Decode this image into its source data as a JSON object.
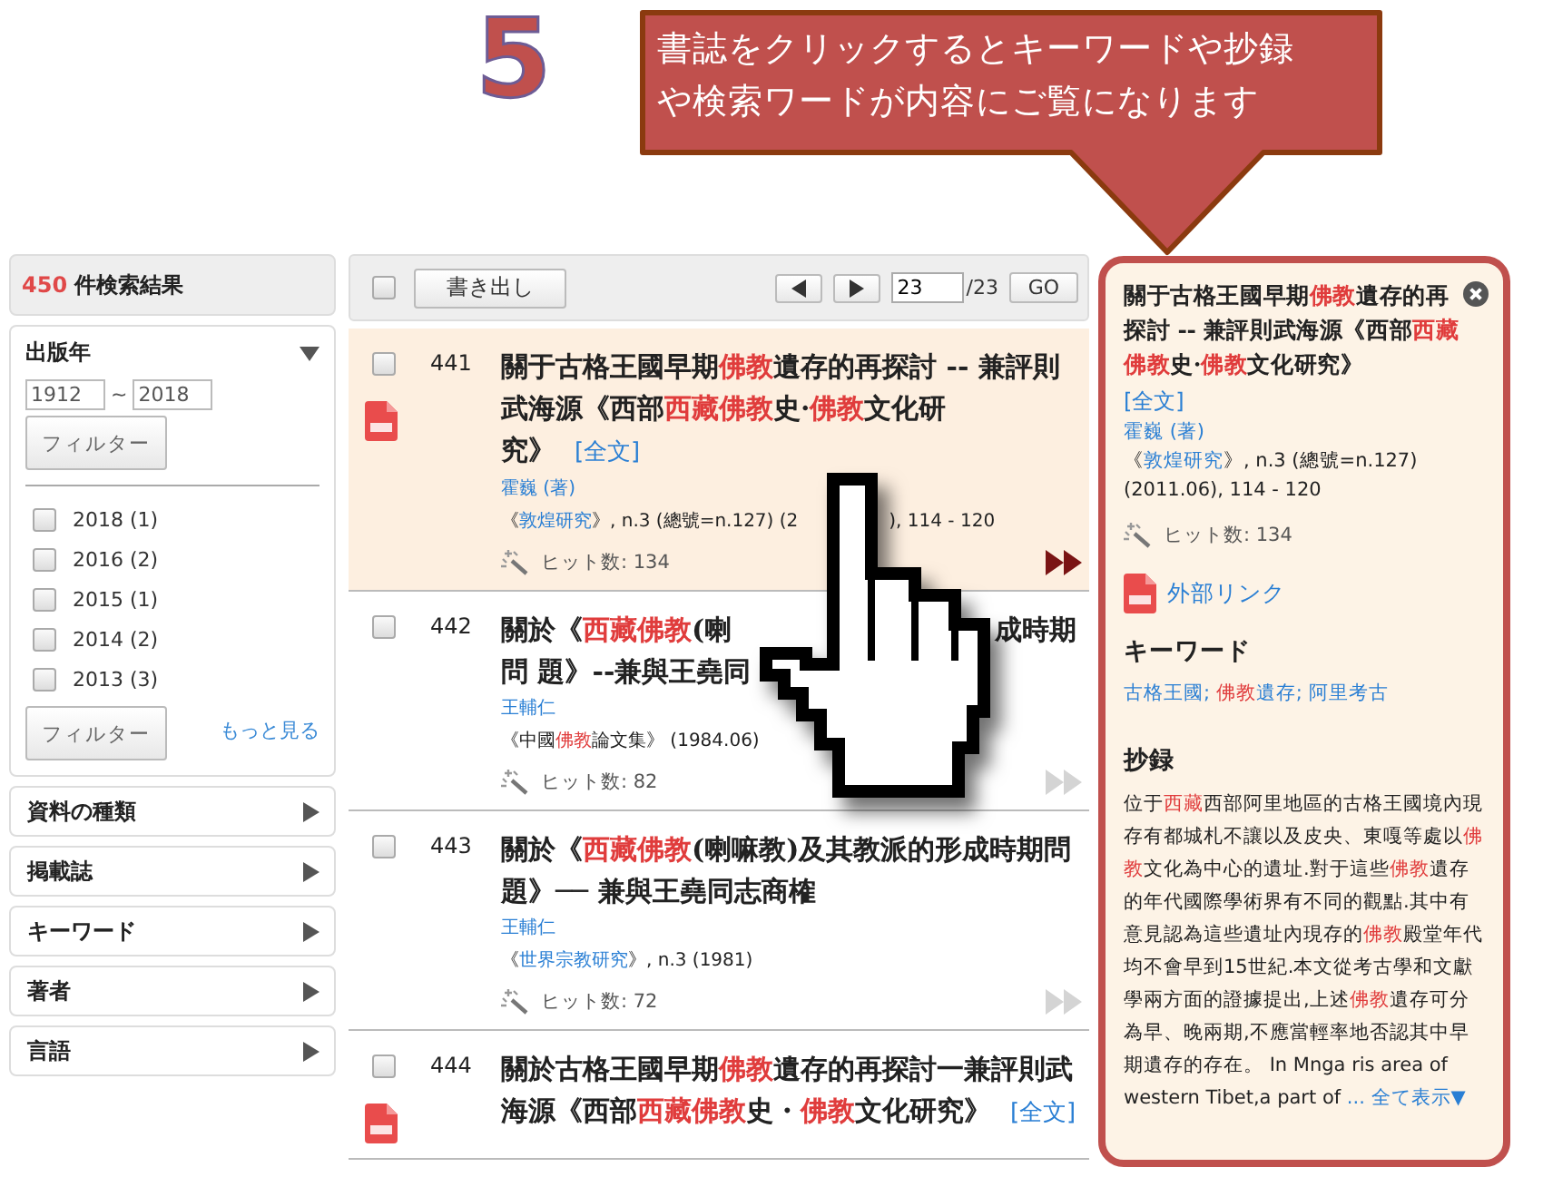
{
  "step_number": "5",
  "callout": {
    "lines": [
      "書誌をクリックするとキーワードや抄録",
      "や検索ワードが内容にご覧になります"
    ]
  },
  "sidebar": {
    "result_count": "450",
    "result_label": "件検索結果",
    "year_facet": {
      "title": "出版年",
      "expanded": true,
      "from": "1912",
      "separator": "~",
      "to": "2018",
      "filter_button": "フィルター",
      "options": [
        {
          "label": "2018 (1)",
          "checked": false
        },
        {
          "label": "2016 (2)",
          "checked": false
        },
        {
          "label": "2015 (1)",
          "checked": false
        },
        {
          "label": "2014 (2)",
          "checked": false
        },
        {
          "label": "2013 (3)",
          "checked": false
        }
      ],
      "filter_button_2": "フィルター",
      "more_link": "もっと見る"
    },
    "facets": [
      {
        "title": "資料の種類",
        "expanded": false
      },
      {
        "title": "掲載誌",
        "expanded": false
      },
      {
        "title": "キーワード",
        "expanded": false
      },
      {
        "title": "著者",
        "expanded": false
      },
      {
        "title": "言語",
        "expanded": false
      }
    ]
  },
  "toolbar": {
    "select_all_checked": false,
    "export_button": "書き出し",
    "page": "23",
    "total": "/23",
    "go_button": "GO"
  },
  "results": [
    {
      "number": "441",
      "checked": false,
      "selected": true,
      "pdf": true,
      "title": "關于古格王國早期**佛教**遺存的再探討 -- 兼評則武海源《西部**西藏佛教**史·**佛教**文化研究》",
      "fulltext": "[全文]",
      "author": "霍巍 (著)",
      "source_open": "《",
      "source_title": "敦煌研究",
      "source_linked": true,
      "source_rest": "》, n.3 (總號=n.127) (2",
      "source_tail": "), 114 - 120",
      "hits": "ヒット数: 134"
    },
    {
      "number": "442",
      "checked": false,
      "selected": false,
      "pdf": false,
      "title": "關於《**西藏佛教**(喇",
      "title_tail": "成時期",
      "title_line2": "問 題》--兼與王堯同",
      "author": "王輔仁",
      "source_open": "《",
      "source_title": "中國**佛教**論文集",
      "source_linked": false,
      "source_rest": "》 (1984.06)",
      "hits": "ヒット数: 82"
    },
    {
      "number": "443",
      "checked": false,
      "selected": false,
      "pdf": false,
      "title": "關於《**西藏佛教**(喇嘛教)及其教派的形成時期問題》── 兼與王堯同志商榷",
      "author": "王輔仁",
      "source_open": "《",
      "source_title": "世界宗教研究",
      "source_linked": true,
      "source_rest": "》, n.3 (1981)",
      "hits": "ヒット数: 72"
    },
    {
      "number": "444",
      "checked": false,
      "selected": false,
      "pdf": true,
      "title": "關於古格王國早期**佛教**遺存的再探討一兼評則武海源《西部**西藏佛教**史・**佛教**文化研究》",
      "fulltext": "[全文]"
    }
  ],
  "detail": {
    "title": "關于古格王國早期**佛教**遺存的再探討 -- 兼評則武海源《西部**西藏佛教**史·**佛教**文化研究》",
    "fulltext": "[全文]",
    "author": "霍巍 (著)",
    "source_open": "《",
    "source_title": "敦煌研究",
    "source_rest": "》, n.3 (總號=n.127) (2011.06), 114 - 120",
    "hits": "ヒット数: 134",
    "external_link": "外部リンク",
    "keywords_heading": "キーワード",
    "keywords": "古格王國; **佛教**遺存; 阿里考古",
    "abstract_heading": "抄録",
    "abstract": "位于**西藏**西部阿里地區的古格王國境內現存有都城札不讓以及皮央、東嘎等處以**佛教**文化為中心的遺址.對于這些**佛教**遺存的年代國際學術界有不同的觀點.其中有意見認為這些遺址內現存的**佛教**殿堂年代均不會早到15世紀.本文從考古學和文獻學兩方面的證據提出,上述**佛教**遺存可分為早、晚兩期,不應當輕率地否認其中早期遺存的存在。 In Mnga ris area of western Tibet,a part of",
    "ellipsis": " ...",
    "show_all": "全て表示▼"
  }
}
